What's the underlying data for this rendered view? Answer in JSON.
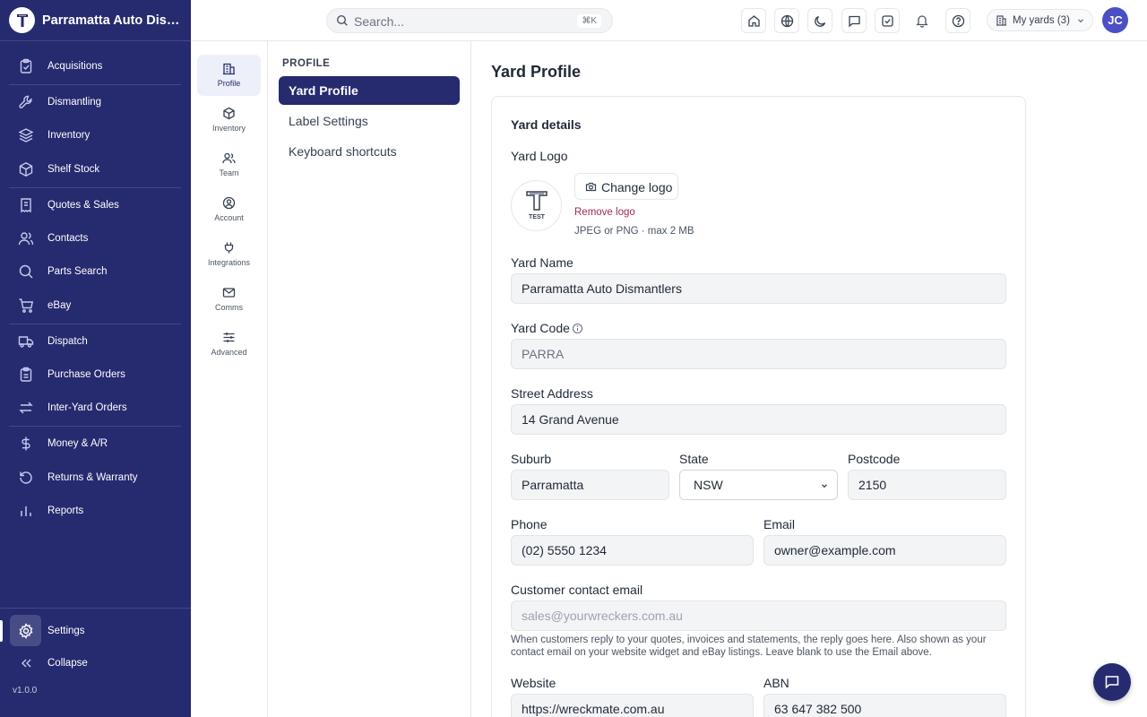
{
  "brand": {
    "name": "Parramatta Auto Dismantlers"
  },
  "nav": {
    "items": [
      {
        "label": "Acquisitions",
        "icon": "clipboard-icon"
      },
      {
        "label": "Dismantling",
        "icon": "wrench-icon"
      },
      {
        "label": "Inventory",
        "icon": "layers-icon"
      },
      {
        "label": "Shelf Stock",
        "icon": "box-icon"
      },
      {
        "label": "Quotes & Sales",
        "icon": "receipt-icon"
      },
      {
        "label": "Contacts",
        "icon": "users-icon"
      },
      {
        "label": "Parts Search",
        "icon": "search-icon"
      },
      {
        "label": "eBay",
        "icon": "cart-icon"
      },
      {
        "label": "Dispatch",
        "icon": "truck-icon"
      },
      {
        "label": "Purchase Orders",
        "icon": "clipboard-list-icon"
      },
      {
        "label": "Inter-Yard Orders",
        "icon": "arrows-exchange-icon"
      },
      {
        "label": "Money & A/R",
        "icon": "dollar-icon"
      },
      {
        "label": "Returns & Warranty",
        "icon": "return-icon"
      },
      {
        "label": "Reports",
        "icon": "bar-chart-icon"
      }
    ],
    "settings": "Settings",
    "collapse": "Collapse",
    "version": "v1.0.0"
  },
  "topbar": {
    "search_placeholder": "Search...",
    "shortcut": "⌘K",
    "yards_label": "My yards (3)",
    "avatar_initials": "JC"
  },
  "rail": {
    "items": [
      {
        "label": "Profile",
        "icon": "building-icon",
        "active": true
      },
      {
        "label": "Inventory",
        "icon": "cube-icon"
      },
      {
        "label": "Team",
        "icon": "team-icon"
      },
      {
        "label": "Account",
        "icon": "user-circle-icon"
      },
      {
        "label": "Integrations",
        "icon": "plug-icon"
      },
      {
        "label": "Comms",
        "icon": "mail-icon"
      },
      {
        "label": "Advanced",
        "icon": "sliders-icon"
      }
    ]
  },
  "subnav": {
    "heading": "PROFILE",
    "items": [
      {
        "label": "Yard Profile",
        "active": true
      },
      {
        "label": "Label Settings"
      },
      {
        "label": "Keyboard shortcuts"
      }
    ]
  },
  "main": {
    "title": "Yard Profile",
    "card_title": "Yard details",
    "logo": {
      "label": "Yard Logo",
      "change": "Change logo",
      "remove": "Remove logo",
      "hint": "JPEG or PNG · max 2 MB",
      "logo_text": "TEST"
    },
    "fields": {
      "yard_name": {
        "label": "Yard Name",
        "value": "Parramatta Auto Dismantlers"
      },
      "yard_code": {
        "label": "Yard Code",
        "value": "PARRA"
      },
      "street": {
        "label": "Street Address",
        "value": "14 Grand Avenue"
      },
      "suburb": {
        "label": "Suburb",
        "value": "Parramatta"
      },
      "state": {
        "label": "State",
        "value": "NSW"
      },
      "postcode": {
        "label": "Postcode",
        "value": "2150"
      },
      "phone": {
        "label": "Phone",
        "value": "(02) 5550 1234"
      },
      "email": {
        "label": "Email",
        "value": "owner@example.com"
      },
      "customer_email": {
        "label": "Customer contact email",
        "placeholder": "sales@yourwreckers.com.au"
      },
      "website": {
        "label": "Website",
        "value": "https://wreckmate.com.au"
      },
      "abn": {
        "label": "ABN",
        "value": "63 647 382 500"
      }
    },
    "customer_email_help": "When customers reply to your quotes, invoices and statements, the reply goes here. Also shown as your contact email on your website widget and eBay listings. Leave blank to use the Email above."
  }
}
